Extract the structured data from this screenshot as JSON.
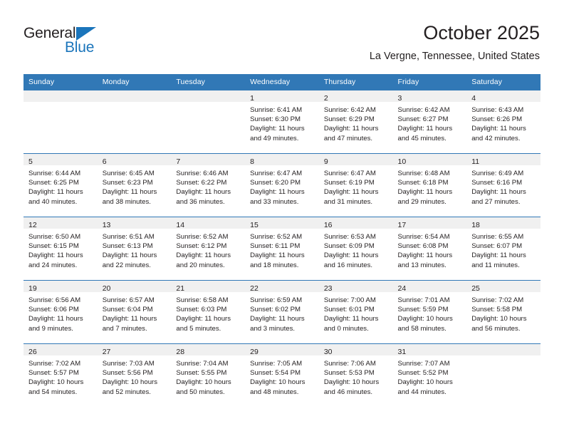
{
  "brand": {
    "name_part1": "General",
    "name_part2": "Blue",
    "accent_color": "#1b75bb"
  },
  "header": {
    "title": "October 2025",
    "location": "La Vergne, Tennessee, United States"
  },
  "calendar": {
    "header_background": "#3178b6",
    "daynum_background": "#f0f0f0",
    "weekday_headers": [
      "Sunday",
      "Monday",
      "Tuesday",
      "Wednesday",
      "Thursday",
      "Friday",
      "Saturday"
    ],
    "weeks": [
      [
        {
          "day": "",
          "sunrise": "",
          "sunset": "",
          "daylight1": "",
          "daylight2": ""
        },
        {
          "day": "",
          "sunrise": "",
          "sunset": "",
          "daylight1": "",
          "daylight2": ""
        },
        {
          "day": "",
          "sunrise": "",
          "sunset": "",
          "daylight1": "",
          "daylight2": ""
        },
        {
          "day": "1",
          "sunrise": "Sunrise: 6:41 AM",
          "sunset": "Sunset: 6:30 PM",
          "daylight1": "Daylight: 11 hours",
          "daylight2": "and 49 minutes."
        },
        {
          "day": "2",
          "sunrise": "Sunrise: 6:42 AM",
          "sunset": "Sunset: 6:29 PM",
          "daylight1": "Daylight: 11 hours",
          "daylight2": "and 47 minutes."
        },
        {
          "day": "3",
          "sunrise": "Sunrise: 6:42 AM",
          "sunset": "Sunset: 6:27 PM",
          "daylight1": "Daylight: 11 hours",
          "daylight2": "and 45 minutes."
        },
        {
          "day": "4",
          "sunrise": "Sunrise: 6:43 AM",
          "sunset": "Sunset: 6:26 PM",
          "daylight1": "Daylight: 11 hours",
          "daylight2": "and 42 minutes."
        }
      ],
      [
        {
          "day": "5",
          "sunrise": "Sunrise: 6:44 AM",
          "sunset": "Sunset: 6:25 PM",
          "daylight1": "Daylight: 11 hours",
          "daylight2": "and 40 minutes."
        },
        {
          "day": "6",
          "sunrise": "Sunrise: 6:45 AM",
          "sunset": "Sunset: 6:23 PM",
          "daylight1": "Daylight: 11 hours",
          "daylight2": "and 38 minutes."
        },
        {
          "day": "7",
          "sunrise": "Sunrise: 6:46 AM",
          "sunset": "Sunset: 6:22 PM",
          "daylight1": "Daylight: 11 hours",
          "daylight2": "and 36 minutes."
        },
        {
          "day": "8",
          "sunrise": "Sunrise: 6:47 AM",
          "sunset": "Sunset: 6:20 PM",
          "daylight1": "Daylight: 11 hours",
          "daylight2": "and 33 minutes."
        },
        {
          "day": "9",
          "sunrise": "Sunrise: 6:47 AM",
          "sunset": "Sunset: 6:19 PM",
          "daylight1": "Daylight: 11 hours",
          "daylight2": "and 31 minutes."
        },
        {
          "day": "10",
          "sunrise": "Sunrise: 6:48 AM",
          "sunset": "Sunset: 6:18 PM",
          "daylight1": "Daylight: 11 hours",
          "daylight2": "and 29 minutes."
        },
        {
          "day": "11",
          "sunrise": "Sunrise: 6:49 AM",
          "sunset": "Sunset: 6:16 PM",
          "daylight1": "Daylight: 11 hours",
          "daylight2": "and 27 minutes."
        }
      ],
      [
        {
          "day": "12",
          "sunrise": "Sunrise: 6:50 AM",
          "sunset": "Sunset: 6:15 PM",
          "daylight1": "Daylight: 11 hours",
          "daylight2": "and 24 minutes."
        },
        {
          "day": "13",
          "sunrise": "Sunrise: 6:51 AM",
          "sunset": "Sunset: 6:13 PM",
          "daylight1": "Daylight: 11 hours",
          "daylight2": "and 22 minutes."
        },
        {
          "day": "14",
          "sunrise": "Sunrise: 6:52 AM",
          "sunset": "Sunset: 6:12 PM",
          "daylight1": "Daylight: 11 hours",
          "daylight2": "and 20 minutes."
        },
        {
          "day": "15",
          "sunrise": "Sunrise: 6:52 AM",
          "sunset": "Sunset: 6:11 PM",
          "daylight1": "Daylight: 11 hours",
          "daylight2": "and 18 minutes."
        },
        {
          "day": "16",
          "sunrise": "Sunrise: 6:53 AM",
          "sunset": "Sunset: 6:09 PM",
          "daylight1": "Daylight: 11 hours",
          "daylight2": "and 16 minutes."
        },
        {
          "day": "17",
          "sunrise": "Sunrise: 6:54 AM",
          "sunset": "Sunset: 6:08 PM",
          "daylight1": "Daylight: 11 hours",
          "daylight2": "and 13 minutes."
        },
        {
          "day": "18",
          "sunrise": "Sunrise: 6:55 AM",
          "sunset": "Sunset: 6:07 PM",
          "daylight1": "Daylight: 11 hours",
          "daylight2": "and 11 minutes."
        }
      ],
      [
        {
          "day": "19",
          "sunrise": "Sunrise: 6:56 AM",
          "sunset": "Sunset: 6:06 PM",
          "daylight1": "Daylight: 11 hours",
          "daylight2": "and 9 minutes."
        },
        {
          "day": "20",
          "sunrise": "Sunrise: 6:57 AM",
          "sunset": "Sunset: 6:04 PM",
          "daylight1": "Daylight: 11 hours",
          "daylight2": "and 7 minutes."
        },
        {
          "day": "21",
          "sunrise": "Sunrise: 6:58 AM",
          "sunset": "Sunset: 6:03 PM",
          "daylight1": "Daylight: 11 hours",
          "daylight2": "and 5 minutes."
        },
        {
          "day": "22",
          "sunrise": "Sunrise: 6:59 AM",
          "sunset": "Sunset: 6:02 PM",
          "daylight1": "Daylight: 11 hours",
          "daylight2": "and 3 minutes."
        },
        {
          "day": "23",
          "sunrise": "Sunrise: 7:00 AM",
          "sunset": "Sunset: 6:01 PM",
          "daylight1": "Daylight: 11 hours",
          "daylight2": "and 0 minutes."
        },
        {
          "day": "24",
          "sunrise": "Sunrise: 7:01 AM",
          "sunset": "Sunset: 5:59 PM",
          "daylight1": "Daylight: 10 hours",
          "daylight2": "and 58 minutes."
        },
        {
          "day": "25",
          "sunrise": "Sunrise: 7:02 AM",
          "sunset": "Sunset: 5:58 PM",
          "daylight1": "Daylight: 10 hours",
          "daylight2": "and 56 minutes."
        }
      ],
      [
        {
          "day": "26",
          "sunrise": "Sunrise: 7:02 AM",
          "sunset": "Sunset: 5:57 PM",
          "daylight1": "Daylight: 10 hours",
          "daylight2": "and 54 minutes."
        },
        {
          "day": "27",
          "sunrise": "Sunrise: 7:03 AM",
          "sunset": "Sunset: 5:56 PM",
          "daylight1": "Daylight: 10 hours",
          "daylight2": "and 52 minutes."
        },
        {
          "day": "28",
          "sunrise": "Sunrise: 7:04 AM",
          "sunset": "Sunset: 5:55 PM",
          "daylight1": "Daylight: 10 hours",
          "daylight2": "and 50 minutes."
        },
        {
          "day": "29",
          "sunrise": "Sunrise: 7:05 AM",
          "sunset": "Sunset: 5:54 PM",
          "daylight1": "Daylight: 10 hours",
          "daylight2": "and 48 minutes."
        },
        {
          "day": "30",
          "sunrise": "Sunrise: 7:06 AM",
          "sunset": "Sunset: 5:53 PM",
          "daylight1": "Daylight: 10 hours",
          "daylight2": "and 46 minutes."
        },
        {
          "day": "31",
          "sunrise": "Sunrise: 7:07 AM",
          "sunset": "Sunset: 5:52 PM",
          "daylight1": "Daylight: 10 hours",
          "daylight2": "and 44 minutes."
        },
        {
          "day": "",
          "sunrise": "",
          "sunset": "",
          "daylight1": "",
          "daylight2": ""
        }
      ]
    ]
  }
}
